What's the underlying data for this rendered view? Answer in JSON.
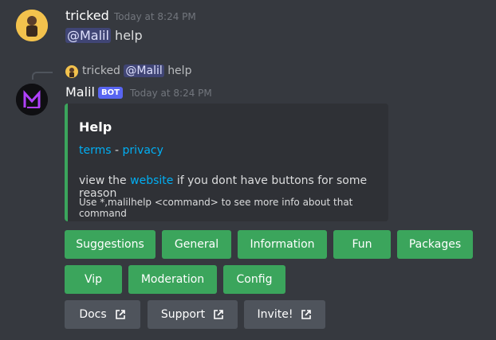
{
  "message1": {
    "username": "tricked",
    "timestamp": "Today at 8:24 PM",
    "mention": "@Malil",
    "text": "help"
  },
  "reply": {
    "username": "tricked",
    "mention": "@Malil",
    "text": "help"
  },
  "message2": {
    "username": "Malil",
    "bot_tag": "BOT",
    "timestamp": "Today at 8:24 PM"
  },
  "embed": {
    "title": "Help",
    "link_terms": "terms",
    "separator": "-",
    "link_privacy": "privacy",
    "line2_prefix": "view the",
    "line2_link": "website",
    "line2_suffix": "if you dont have buttons for some reason",
    "line3": "Use *,malilhelp <command> to see more info about that command",
    "accent_color": "#3ba55c"
  },
  "buttons": {
    "row1": [
      "Suggestions",
      "General",
      "Information",
      "Fun",
      "Packages"
    ],
    "row2": [
      "Vip",
      "Moderation",
      "Config"
    ],
    "row3": [
      "Docs",
      "Support",
      "Invite!"
    ]
  },
  "icons": {
    "external_link": "external-link-icon"
  }
}
